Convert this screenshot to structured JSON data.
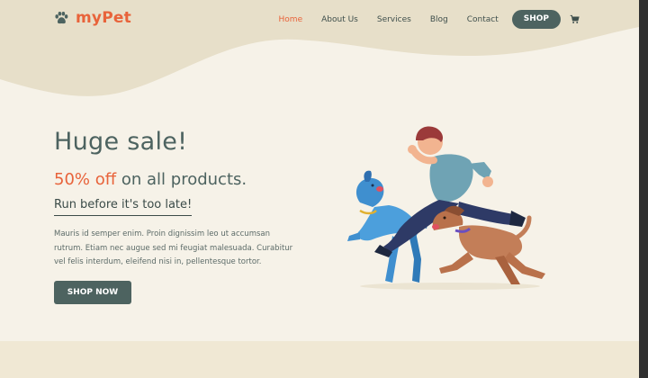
{
  "brand": {
    "name": "myPet",
    "icon": "paw-icon",
    "color": "#e8633a"
  },
  "nav": {
    "items": [
      {
        "label": "Home",
        "active": true
      },
      {
        "label": "About Us",
        "active": false
      },
      {
        "label": "Services",
        "active": false
      },
      {
        "label": "Blog",
        "active": false
      },
      {
        "label": "Contact",
        "active": false
      }
    ],
    "shop_label": "SHOP",
    "cart_icon": "cart-icon"
  },
  "hero": {
    "headline": "Huge sale!",
    "offer_accent": "50% off",
    "offer_rest": " on all products.",
    "tagline": "Run before it's too late!",
    "description": "Mauris id semper enim. Proin dignissim leo ut accumsan rutrum. Etiam nec augue sed mi feugiat malesuada. Curabitur vel felis interdum, eleifend nisi in, pellentesque tortor.",
    "cta_label": "SHOP NOW"
  },
  "colors": {
    "accent": "#e8633a",
    "primary": "#4d6360",
    "background": "#f6f2e8",
    "wave": "#e7dfc9"
  }
}
